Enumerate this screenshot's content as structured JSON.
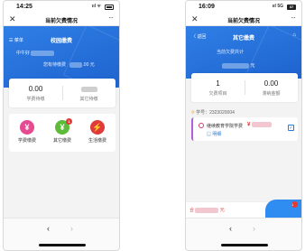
{
  "left": {
    "status": {
      "time": "14:25",
      "network": "all",
      "battery": ""
    },
    "titlebar": {
      "close": "✕",
      "title": "当前欠费情况",
      "more": "···"
    },
    "header": {
      "menu_label": "菜单",
      "title": "校园缴费",
      "name_prefix": "中午好",
      "fee_label": "您有待缴费",
      "fee_suffix": ".00",
      "fee_unit": "元"
    },
    "stats": [
      {
        "value": "0.00",
        "label": "学费待缴"
      },
      {
        "value": "",
        "label": "其它待缴"
      }
    ],
    "services": [
      {
        "icon": "yen-icon",
        "glyph": "¥",
        "label": "学费缴费",
        "color": "#e64a91"
      },
      {
        "icon": "yen-icon",
        "glyph": "¥",
        "label": "其它缴费",
        "color": "#5cbc3a",
        "badge": "1"
      },
      {
        "icon": "utility-icon",
        "glyph": "⚡",
        "label": "生活缴费",
        "color": "#e03a3a"
      }
    ],
    "nav": {
      "back": "‹",
      "forward": "›"
    }
  },
  "right": {
    "status": {
      "time": "16:09",
      "network": "5G",
      "battery": "37"
    },
    "titlebar": {
      "close": "✕",
      "title": "当前欠费情况",
      "more": "···"
    },
    "header": {
      "back_label": "〈 返回",
      "title": "其它缴费",
      "total_label": "当前欠费共计",
      "amount_unit": "元"
    },
    "stats": [
      {
        "value": "1",
        "label": "欠费项目"
      },
      {
        "value": "0.00",
        "label": "滞纳金额"
      }
    ],
    "student": {
      "label": "学号：",
      "value": "2323020004"
    },
    "fee_item": {
      "name": "继续教育学院学费",
      "details_label": "明细",
      "currency": "¥"
    },
    "footer": {
      "total_label": "合",
      "total_unit": "元",
      "badge": "1"
    },
    "nav": {
      "back": "‹",
      "forward": "›"
    }
  },
  "colors": {
    "primary": "#2f7fe6",
    "danger": "#e53935",
    "link": "#2a7be0"
  }
}
